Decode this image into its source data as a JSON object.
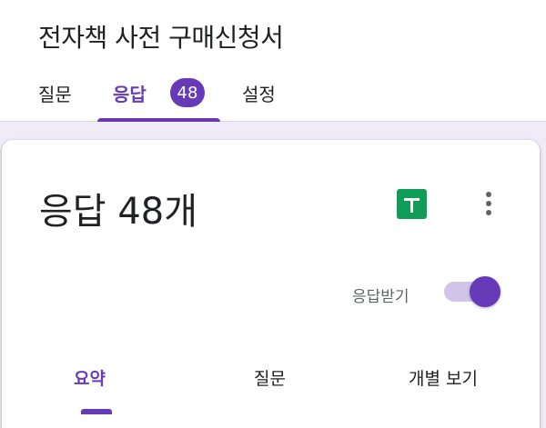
{
  "header": {
    "form_title": "전자책 사전 구매신청서",
    "tabs": [
      {
        "label": "질문"
      },
      {
        "label": "응답",
        "badge": "48"
      },
      {
        "label": "설정"
      }
    ]
  },
  "card": {
    "title": "응답 48개",
    "accept_label": "응답받기",
    "accepting": true,
    "subtabs": [
      {
        "label": "요약"
      },
      {
        "label": "질문"
      },
      {
        "label": "개별 보기"
      }
    ]
  },
  "colors": {
    "accent": "#673ab7",
    "sheets": "#0f9d58",
    "background": "#efebf8"
  },
  "icons": [
    "sheets-icon",
    "more-vert-icon"
  ]
}
